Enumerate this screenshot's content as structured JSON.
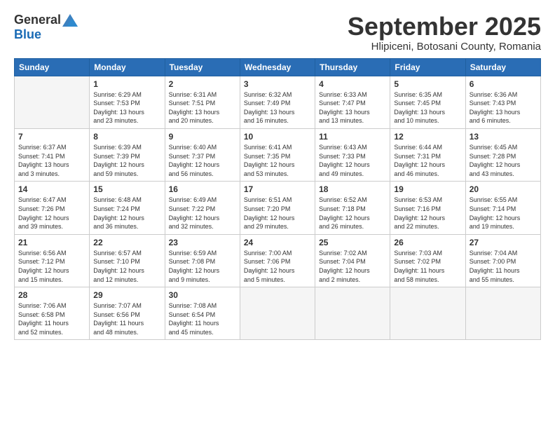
{
  "logo": {
    "general": "General",
    "blue": "Blue"
  },
  "title": "September 2025",
  "location": "Hlipiceni, Botosani County, Romania",
  "days_header": [
    "Sunday",
    "Monday",
    "Tuesday",
    "Wednesday",
    "Thursday",
    "Friday",
    "Saturday"
  ],
  "weeks": [
    [
      {
        "num": "",
        "info": ""
      },
      {
        "num": "1",
        "info": "Sunrise: 6:29 AM\nSunset: 7:53 PM\nDaylight: 13 hours\nand 23 minutes."
      },
      {
        "num": "2",
        "info": "Sunrise: 6:31 AM\nSunset: 7:51 PM\nDaylight: 13 hours\nand 20 minutes."
      },
      {
        "num": "3",
        "info": "Sunrise: 6:32 AM\nSunset: 7:49 PM\nDaylight: 13 hours\nand 16 minutes."
      },
      {
        "num": "4",
        "info": "Sunrise: 6:33 AM\nSunset: 7:47 PM\nDaylight: 13 hours\nand 13 minutes."
      },
      {
        "num": "5",
        "info": "Sunrise: 6:35 AM\nSunset: 7:45 PM\nDaylight: 13 hours\nand 10 minutes."
      },
      {
        "num": "6",
        "info": "Sunrise: 6:36 AM\nSunset: 7:43 PM\nDaylight: 13 hours\nand 6 minutes."
      }
    ],
    [
      {
        "num": "7",
        "info": "Sunrise: 6:37 AM\nSunset: 7:41 PM\nDaylight: 13 hours\nand 3 minutes."
      },
      {
        "num": "8",
        "info": "Sunrise: 6:39 AM\nSunset: 7:39 PM\nDaylight: 12 hours\nand 59 minutes."
      },
      {
        "num": "9",
        "info": "Sunrise: 6:40 AM\nSunset: 7:37 PM\nDaylight: 12 hours\nand 56 minutes."
      },
      {
        "num": "10",
        "info": "Sunrise: 6:41 AM\nSunset: 7:35 PM\nDaylight: 12 hours\nand 53 minutes."
      },
      {
        "num": "11",
        "info": "Sunrise: 6:43 AM\nSunset: 7:33 PM\nDaylight: 12 hours\nand 49 minutes."
      },
      {
        "num": "12",
        "info": "Sunrise: 6:44 AM\nSunset: 7:31 PM\nDaylight: 12 hours\nand 46 minutes."
      },
      {
        "num": "13",
        "info": "Sunrise: 6:45 AM\nSunset: 7:28 PM\nDaylight: 12 hours\nand 43 minutes."
      }
    ],
    [
      {
        "num": "14",
        "info": "Sunrise: 6:47 AM\nSunset: 7:26 PM\nDaylight: 12 hours\nand 39 minutes."
      },
      {
        "num": "15",
        "info": "Sunrise: 6:48 AM\nSunset: 7:24 PM\nDaylight: 12 hours\nand 36 minutes."
      },
      {
        "num": "16",
        "info": "Sunrise: 6:49 AM\nSunset: 7:22 PM\nDaylight: 12 hours\nand 32 minutes."
      },
      {
        "num": "17",
        "info": "Sunrise: 6:51 AM\nSunset: 7:20 PM\nDaylight: 12 hours\nand 29 minutes."
      },
      {
        "num": "18",
        "info": "Sunrise: 6:52 AM\nSunset: 7:18 PM\nDaylight: 12 hours\nand 26 minutes."
      },
      {
        "num": "19",
        "info": "Sunrise: 6:53 AM\nSunset: 7:16 PM\nDaylight: 12 hours\nand 22 minutes."
      },
      {
        "num": "20",
        "info": "Sunrise: 6:55 AM\nSunset: 7:14 PM\nDaylight: 12 hours\nand 19 minutes."
      }
    ],
    [
      {
        "num": "21",
        "info": "Sunrise: 6:56 AM\nSunset: 7:12 PM\nDaylight: 12 hours\nand 15 minutes."
      },
      {
        "num": "22",
        "info": "Sunrise: 6:57 AM\nSunset: 7:10 PM\nDaylight: 12 hours\nand 12 minutes."
      },
      {
        "num": "23",
        "info": "Sunrise: 6:59 AM\nSunset: 7:08 PM\nDaylight: 12 hours\nand 9 minutes."
      },
      {
        "num": "24",
        "info": "Sunrise: 7:00 AM\nSunset: 7:06 PM\nDaylight: 12 hours\nand 5 minutes."
      },
      {
        "num": "25",
        "info": "Sunrise: 7:02 AM\nSunset: 7:04 PM\nDaylight: 12 hours\nand 2 minutes."
      },
      {
        "num": "26",
        "info": "Sunrise: 7:03 AM\nSunset: 7:02 PM\nDaylight: 11 hours\nand 58 minutes."
      },
      {
        "num": "27",
        "info": "Sunrise: 7:04 AM\nSunset: 7:00 PM\nDaylight: 11 hours\nand 55 minutes."
      }
    ],
    [
      {
        "num": "28",
        "info": "Sunrise: 7:06 AM\nSunset: 6:58 PM\nDaylight: 11 hours\nand 52 minutes."
      },
      {
        "num": "29",
        "info": "Sunrise: 7:07 AM\nSunset: 6:56 PM\nDaylight: 11 hours\nand 48 minutes."
      },
      {
        "num": "30",
        "info": "Sunrise: 7:08 AM\nSunset: 6:54 PM\nDaylight: 11 hours\nand 45 minutes."
      },
      {
        "num": "",
        "info": ""
      },
      {
        "num": "",
        "info": ""
      },
      {
        "num": "",
        "info": ""
      },
      {
        "num": "",
        "info": ""
      }
    ]
  ]
}
